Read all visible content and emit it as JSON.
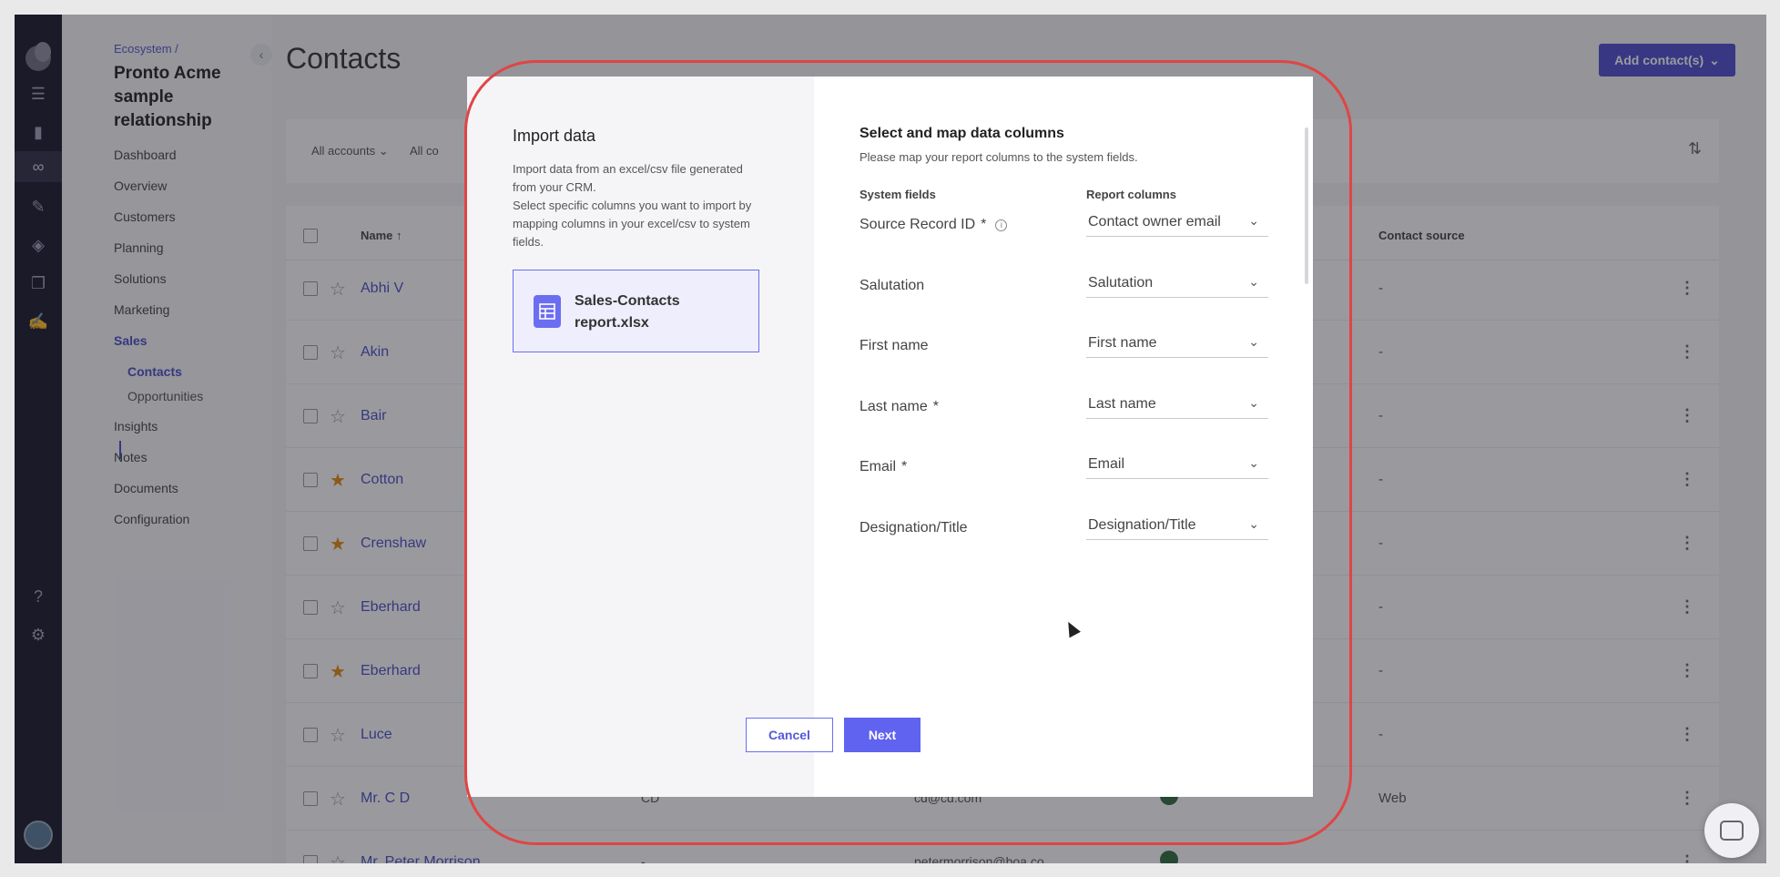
{
  "sidebar": {
    "breadcrumb": "Ecosystem /",
    "workspace_title": "Pronto Acme sample relationship",
    "items": [
      {
        "label": "Dashboard"
      },
      {
        "label": "Overview"
      },
      {
        "label": "Customers"
      },
      {
        "label": "Planning"
      },
      {
        "label": "Solutions"
      },
      {
        "label": "Marketing"
      },
      {
        "label": "Sales"
      },
      {
        "label": "Insights"
      },
      {
        "label": "Notes"
      },
      {
        "label": "Documents"
      },
      {
        "label": "Configuration"
      }
    ],
    "sales_sub": [
      {
        "label": "Contacts"
      },
      {
        "label": "Opportunities"
      }
    ],
    "collapse_icon": "chevron-left-icon"
  },
  "rail": {
    "icons": [
      "logo-icon",
      "checklist-icon",
      "bar-chart-icon",
      "handshake-icon",
      "pen-icon",
      "diamond-icon",
      "layers-icon",
      "edit-icon",
      "help-icon",
      "settings-icon"
    ]
  },
  "main": {
    "title": "Contacts",
    "add_button": "Add contact(s)",
    "filters": [
      "All accounts",
      "All co"
    ],
    "table": {
      "columns": {
        "name": "Name",
        "source": "Contact source"
      },
      "rows": [
        {
          "name": "Abhi V",
          "starred": false,
          "source": "-"
        },
        {
          "name": "Akin",
          "starred": false,
          "source": "-"
        },
        {
          "name": "Bair",
          "starred": false,
          "source": "-"
        },
        {
          "name": "Cotton",
          "starred": true,
          "source": "-"
        },
        {
          "name": "Crenshaw",
          "starred": true,
          "source": "-"
        },
        {
          "name": "Eberhard",
          "starred": false,
          "source": "-"
        },
        {
          "name": "Eberhard",
          "starred": true,
          "source": "-"
        },
        {
          "name": "Luce",
          "starred": false,
          "source": "-"
        },
        {
          "name": "Mr. C D",
          "starred": false,
          "source": "Web",
          "col2": "CD",
          "col3": "cd@cd.com"
        },
        {
          "name": "Mr. Peter Morrison",
          "starred": false,
          "source": "",
          "col2": "-",
          "col3": "petermorrison@boa.co",
          "col4": "-"
        }
      ]
    }
  },
  "modal": {
    "title": "Import data",
    "description": "Import data from an excel/csv file generated from your CRM.\nSelect specific columns you want to import by mapping columns in your excel/csv to system fields.",
    "file_name": "Sales-Contacts report.xlsx",
    "mapping_title": "Select and map data columns",
    "mapping_subtitle": "Please map your report columns to the system fields.",
    "header_system": "System fields",
    "header_report": "Report columns",
    "mappings": [
      {
        "field": "Source Record ID",
        "required": "*",
        "info": "i",
        "value": "Contact owner email"
      },
      {
        "field": "Salutation",
        "required": "",
        "value": "Salutation"
      },
      {
        "field": "First name",
        "required": "",
        "value": "First name"
      },
      {
        "field": "Last name",
        "required": "*",
        "value": "Last name"
      },
      {
        "field": "Email",
        "required": "*",
        "value": "Email"
      },
      {
        "field": "Designation/Title",
        "required": "",
        "value": "Designation/Title"
      }
    ],
    "cancel": "Cancel",
    "next": "Next"
  },
  "colors": {
    "accent": "#4b4bd0",
    "highlight": "#e04545",
    "star_on": "#e58a10"
  }
}
